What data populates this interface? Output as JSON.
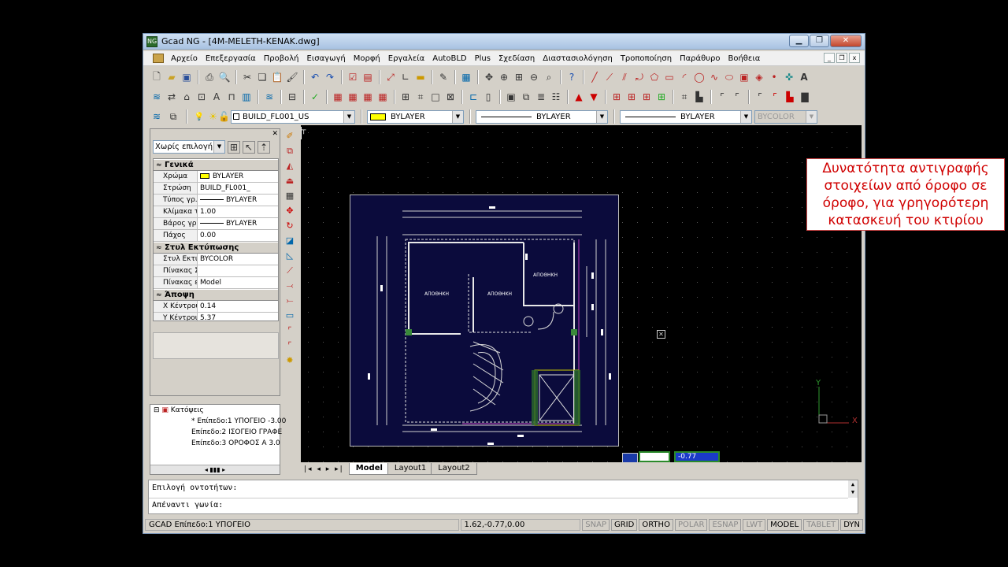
{
  "window": {
    "title": "Gcad NG - [4M-MELETH-KENAK.dwg]"
  },
  "menu": [
    "Αρχείο",
    "Επεξεργασία",
    "Προβολή",
    "Εισαγωγή",
    "Μορφή",
    "Εργαλεία",
    "AutoBLD",
    "Plus",
    "Σχεδίαση",
    "Διαστασιολόγηση",
    "Τροποποίηση",
    "Παράθυρο",
    "Βοήθεια"
  ],
  "layerbar": {
    "layer": "BUILD_FL001_US",
    "color": "BYLAYER",
    "linetype": "BYLAYER",
    "lineweight": "BYLAYER",
    "plotstyle": "BYCOLOR"
  },
  "properties": {
    "selection": "Χωρίς επιλογή",
    "sections": {
      "general": "Γενικά",
      "plot": "Στυλ Εκτύπωσης",
      "view": "Άποψη"
    },
    "general_rows": [
      {
        "k": "Χρώμα",
        "v": "BYLAYER"
      },
      {
        "k": "Στρώση",
        "v": "BUILD_FL001_"
      },
      {
        "k": "Τύπος γρ...",
        "v": "BYLAYER"
      },
      {
        "k": "Κλίμακα τ...",
        "v": "1.00"
      },
      {
        "k": "Βάρος γρ...",
        "v": "BYLAYER"
      },
      {
        "k": "Πάχος",
        "v": "0.00"
      }
    ],
    "plot_rows": [
      {
        "k": "Στυλ Εκτύ...",
        "v": "BYCOLOR"
      },
      {
        "k": "Πίνακας Σ...",
        "v": ""
      },
      {
        "k": "Πίνακας ε...",
        "v": "Model"
      }
    ],
    "view_rows": [
      {
        "k": "Χ Κέντρου",
        "v": "0.14"
      },
      {
        "k": "Υ Κέντρου",
        "v": "5.37"
      }
    ]
  },
  "tree": {
    "root": "Κατόψεις",
    "items": [
      "Επίπεδο:1 ΥΠΟΓΕΙΟ -3.00",
      "Επίπεδο:2 ΙΣΟΓΕΙΟ ΓΡΑΦΕ",
      "Επίπεδο:3 ΟΡΟΦΟΣ Α 3.0"
    ]
  },
  "callout": "Δυνατότητα αντιγραφής στοιχείων από όροφο σε όροφο, για γρηγορότερη κατασκευή του κτιρίου",
  "rooms": [
    "ΑΠΟΘΗΚΗ",
    "ΑΠΟΘΗΚΗ",
    "ΑΠΟΘΗΚΗ"
  ],
  "dyn_input": "-0.77",
  "tabs": [
    "Model",
    "Layout1",
    "Layout2"
  ],
  "cmd": {
    "line1": "Επιλογή οντοτήτων:",
    "line2": "Απέναντι γωνία:"
  },
  "status": {
    "left": "GCAD Επίπεδο:1 ΥΠΟΓΕΙΟ",
    "coords": "1.62,-0.77,0.00",
    "toggles": [
      {
        "label": "SNAP",
        "on": false
      },
      {
        "label": "GRID",
        "on": true
      },
      {
        "label": "ORTHO",
        "on": true
      },
      {
        "label": "POLAR",
        "on": false
      },
      {
        "label": "ESNAP",
        "on": false
      },
      {
        "label": "LWT",
        "on": false
      },
      {
        "label": "MODEL",
        "on": true
      },
      {
        "label": "TABLET",
        "on": false
      },
      {
        "label": "DYN",
        "on": true
      }
    ]
  },
  "ucs": {
    "x": "X",
    "y": "Y"
  }
}
